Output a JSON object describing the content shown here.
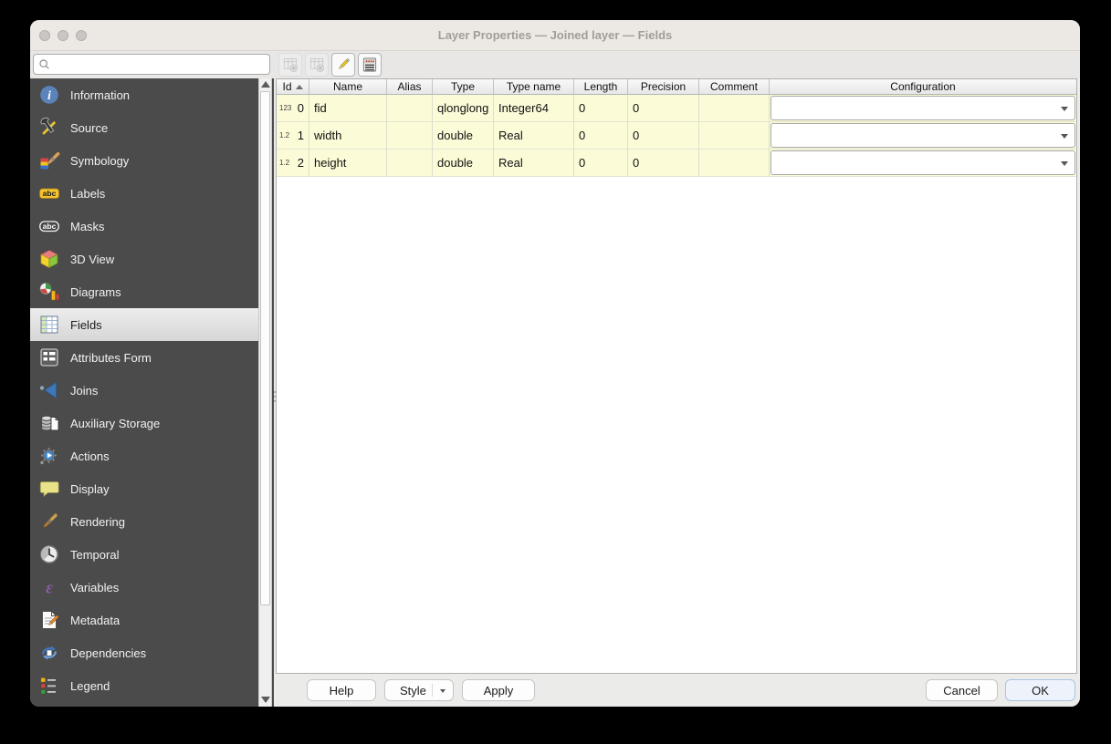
{
  "window": {
    "title": "Layer Properties — Joined layer — Fields"
  },
  "sidebar": {
    "search": {
      "value": "",
      "placeholder": ""
    },
    "selected_item": "Fields",
    "items": [
      {
        "label": "Information"
      },
      {
        "label": "Source"
      },
      {
        "label": "Symbology"
      },
      {
        "label": "Labels"
      },
      {
        "label": "Masks"
      },
      {
        "label": "3D View"
      },
      {
        "label": "Diagrams"
      },
      {
        "label": "Fields"
      },
      {
        "label": "Attributes Form"
      },
      {
        "label": "Joins"
      },
      {
        "label": "Auxiliary Storage"
      },
      {
        "label": "Actions"
      },
      {
        "label": "Display"
      },
      {
        "label": "Rendering"
      },
      {
        "label": "Temporal"
      },
      {
        "label": "Variables"
      },
      {
        "label": "Metadata"
      },
      {
        "label": "Dependencies"
      },
      {
        "label": "Legend"
      }
    ]
  },
  "toolbar": {
    "buttons": [
      {
        "icon": "new-field-icon",
        "enabled": false
      },
      {
        "icon": "delete-field-icon",
        "enabled": false
      },
      {
        "icon": "toggle-editing-pencil-icon",
        "enabled": true
      },
      {
        "icon": "field-calculator-icon",
        "enabled": true
      }
    ]
  },
  "fields_table": {
    "columns": [
      {
        "label": "Id",
        "sort": "asc"
      },
      {
        "label": "Name"
      },
      {
        "label": "Alias"
      },
      {
        "label": "Type"
      },
      {
        "label": "Type name"
      },
      {
        "label": "Length"
      },
      {
        "label": "Precision"
      },
      {
        "label": "Comment"
      },
      {
        "label": "Configuration"
      }
    ],
    "rows": [
      {
        "badge": "123",
        "id": "0",
        "name": "fid",
        "alias": "",
        "type": "qlonglong",
        "type_name": "Integer64",
        "length": "0",
        "precision": "0",
        "comment": "",
        "configuration": ""
      },
      {
        "badge": "1.2",
        "id": "1",
        "name": "width",
        "alias": "",
        "type": "double",
        "type_name": "Real",
        "length": "0",
        "precision": "0",
        "comment": "",
        "configuration": ""
      },
      {
        "badge": "1.2",
        "id": "2",
        "name": "height",
        "alias": "",
        "type": "double",
        "type_name": "Real",
        "length": "0",
        "precision": "0",
        "comment": "",
        "configuration": ""
      }
    ]
  },
  "footer": {
    "help_label": "Help",
    "style_label": "Style",
    "apply_label": "Apply",
    "cancel_label": "Cancel",
    "ok_label": "OK"
  },
  "colors": {
    "row_background": "#fbfbd8",
    "sidebar_background": "#4b4b4b",
    "selected_item_background": "#e0e0e0",
    "ok_button_border": "#a9c3e4",
    "title_text": "#a39d98"
  }
}
